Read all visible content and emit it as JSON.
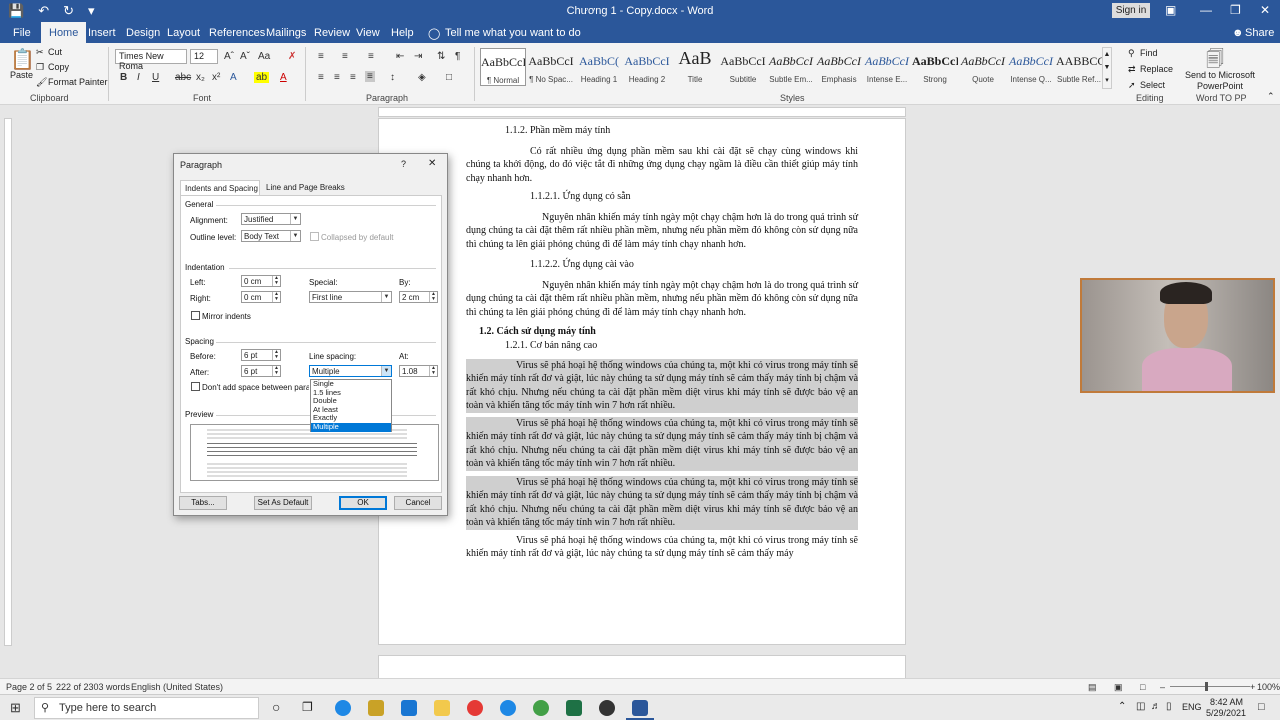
{
  "titlebar": {
    "title": "Chương 1 - Copy.docx  -  Word",
    "signin": "Sign in"
  },
  "tabs": [
    "File",
    "Home",
    "Insert",
    "Design",
    "Layout",
    "References",
    "Mailings",
    "Review",
    "View",
    "Help"
  ],
  "tell_me": "Tell me what you want to do",
  "share": "Share",
  "clipboard": {
    "paste": "Paste",
    "cut": "Cut",
    "copy": "Copy",
    "format_painter": "Format Painter",
    "group": "Clipboard"
  },
  "font": {
    "name": "Times New Roma",
    "size": "12",
    "group": "Font"
  },
  "paragraph_group": "Paragraph",
  "styles_group": "Styles",
  "styles": [
    {
      "preview": "AaBbCcI",
      "name": "¶ Normal"
    },
    {
      "preview": "AaBbCcI",
      "name": "¶ No Spac..."
    },
    {
      "preview": "AaBbC(",
      "name": "Heading 1"
    },
    {
      "preview": "AaBbCcI",
      "name": "Heading 2"
    },
    {
      "preview": "AaB",
      "name": "Title"
    },
    {
      "preview": "AaBbCcI",
      "name": "Subtitle"
    },
    {
      "preview": "AaBbCcI",
      "name": "Subtle Em..."
    },
    {
      "preview": "AaBbCcI",
      "name": "Emphasis"
    },
    {
      "preview": "AaBbCcI",
      "name": "Intense E..."
    },
    {
      "preview": "AaBbCcI",
      "name": "Strong"
    },
    {
      "preview": "AaBbCcI",
      "name": "Quote"
    },
    {
      "preview": "AaBbCcI",
      "name": "Intense Q..."
    },
    {
      "preview": "AABBCCI",
      "name": "Subtle Ref..."
    }
  ],
  "editing": {
    "find": "Find",
    "replace": "Replace",
    "select": "Select",
    "group": "Editing"
  },
  "send_ppt": {
    "label1": "Send to Microsoft",
    "label2": "PowerPoint",
    "group": "Word TO PP"
  },
  "document": {
    "h_112": "1.1.2. Phần mềm máy tính",
    "p1": "Có rất nhiều ứng dụng phần mềm sau khi cài đặt sẽ chạy cùng windows khi chúng ta khởi động, do đó việc tắt đi những ứng dụng chạy ngầm là điều cần thiết giúp máy tính chạy nhanh hơn.",
    "h_1121": "1.1.2.1. Ứng dụng có sẵn",
    "p2": "Nguyên nhân khiến máy tính ngày một chạy chậm hơn là do trong quá trình sử dụng chúng ta cài đặt thêm rất nhiều phần mềm, nhưng nếu phần mềm đó không còn sử dụng nữa thì chúng ta lên giải phóng chúng đi để làm máy tính chạy nhanh hơn.",
    "h_1122": "1.1.2.2. Ứng dụng cài vào",
    "p3": "Nguyên nhân khiến máy tính ngày một chạy chậm hơn là do trong quá trình sử dụng chúng ta cài đặt thêm rất nhiều phần mềm, nhưng nếu phần mềm đó không còn sử dụng nữa thì chúng ta lên giải phóng chúng đi để làm máy tính chạy nhanh hơn.",
    "h_12": "1.2.  Cách sử dụng máy tính",
    "h_121": "1.2.1. Cơ bản nâng cao",
    "p_virus": "Virus sẽ phá hoại hệ thống windows của chúng ta, một khi có virus trong máy tính sẽ khiến máy tính rất đơ và giật, lúc này chúng ta sử dụng máy tính sẽ cảm thấy máy tính bị chậm và rất khó chịu. Nhưng nếu chúng ta cài đặt phần mềm diệt virus khi máy tính sẽ được bảo vệ an toàn và khiến tăng tốc máy tính win 7 hơn rất nhiều.",
    "p_virus_last": "Virus sẽ phá hoại hệ thống windows của chúng ta, một khi có virus trong máy tính sẽ khiến máy tính rất đơ và giật, lúc này chúng ta sử dụng máy tính sẽ cảm thấy máy"
  },
  "dialog": {
    "title": "Paragraph",
    "help": "?",
    "close": "✕",
    "tab1": "Indents and Spacing",
    "tab2": "Line and Page Breaks",
    "general": "General",
    "alignment_label": "Alignment:",
    "alignment": "Justified",
    "outline_label": "Outline level:",
    "outline": "Body Text",
    "collapsed": "Collapsed by default",
    "indentation": "Indentation",
    "left_label": "Left:",
    "left": "0 cm",
    "right_label": "Right:",
    "right": "0 cm",
    "special_label": "Special:",
    "special": "First line",
    "by_label": "By:",
    "by": "2 cm",
    "mirror": "Mirror indents",
    "spacing": "Spacing",
    "before_label": "Before:",
    "before": "6 pt",
    "after_label": "After:",
    "after": "6 pt",
    "line_spacing_label": "Line spacing:",
    "line_spacing": "Multiple",
    "at_label": "At:",
    "at": "1.08",
    "dont_add": "Don't add space between para",
    "preview": "Preview",
    "line_spacing_options": [
      "Single",
      "1.5 lines",
      "Double",
      "At least",
      "Exactly",
      "Multiple"
    ],
    "tabs_btn": "Tabs...",
    "default_btn": "Set As Default",
    "ok_btn": "OK",
    "cancel_btn": "Cancel"
  },
  "statusbar": {
    "page": "Page 2 of 5",
    "words": "222 of 2303 words",
    "lang": "English (United States)",
    "zoom": "100%"
  },
  "taskbar": {
    "search": "Type here to search",
    "time": "8:42 AM",
    "date": "5/29/2021",
    "lang": "ENG"
  }
}
